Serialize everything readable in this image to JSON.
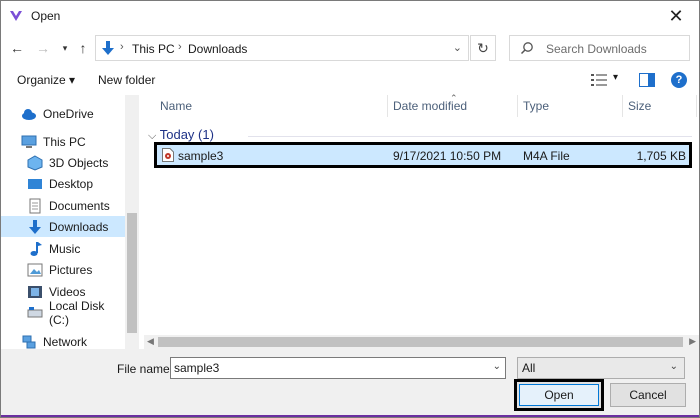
{
  "window": {
    "title": "Open",
    "accent": "#7b4fd6"
  },
  "address": {
    "crumbs": [
      "This PC",
      "Downloads"
    ],
    "separator": "›"
  },
  "search": {
    "placeholder": "Search Downloads"
  },
  "toolbar": {
    "organize": "Organize ▾",
    "new_folder": "New folder"
  },
  "sidebar": {
    "items": [
      {
        "label": "OneDrive",
        "icon": "cloud-icon"
      },
      {
        "label": "This PC",
        "icon": "computer-icon"
      },
      {
        "label": "3D Objects",
        "icon": "cube-icon"
      },
      {
        "label": "Desktop",
        "icon": "desktop-icon"
      },
      {
        "label": "Documents",
        "icon": "documents-icon"
      },
      {
        "label": "Downloads",
        "icon": "download-arrow-icon",
        "selected": true
      },
      {
        "label": "Music",
        "icon": "music-note-icon"
      },
      {
        "label": "Pictures",
        "icon": "pictures-icon"
      },
      {
        "label": "Videos",
        "icon": "film-icon"
      },
      {
        "label": "Local Disk (C:)",
        "icon": "drive-icon"
      },
      {
        "label": "Network",
        "icon": "network-icon"
      }
    ]
  },
  "columns": {
    "name": "Name",
    "date": "Date modified",
    "type": "Type",
    "size": "Size"
  },
  "group": {
    "label": "Today (1)"
  },
  "file": {
    "name": "sample3",
    "date": "9/17/2021 10:50 PM",
    "type": "M4A File",
    "size": "1,705 KB"
  },
  "bottom": {
    "file_name_label": "File name:",
    "file_name_value": "sample3",
    "file_type": "All",
    "open_label": "Open",
    "cancel_label": "Cancel"
  }
}
